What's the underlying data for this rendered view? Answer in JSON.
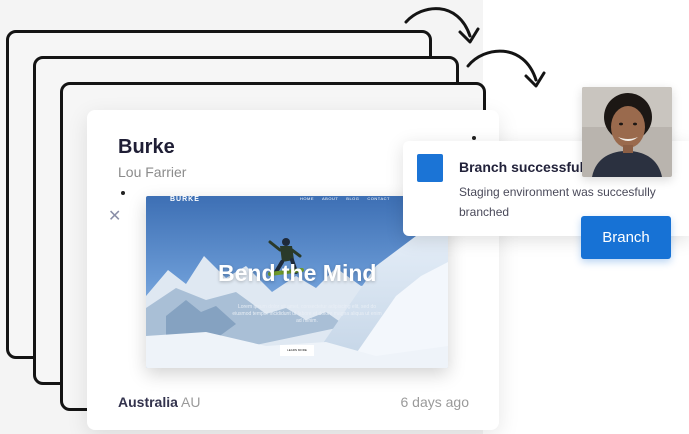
{
  "card": {
    "title": "Burke",
    "subtitle": "Lou Farrier",
    "location_name": "Australia",
    "location_code": "AU",
    "time_ago": "6 days ago"
  },
  "preview": {
    "brand": "BURKE",
    "nav": [
      "HOME",
      "ABOUT",
      "BLOG",
      "CONTACT"
    ],
    "headline": "Bend the Mind",
    "body": "Lorem ipsum dolor sit amet, consectetur adipiscing elit, sed do eiusmod tempor incididunt ut labore et dolore magna aliqua ut enim ad minim.",
    "cta": "LEARN MORE"
  },
  "toast": {
    "title": "Branch successful",
    "message": "Staging environment was succesfully branched"
  },
  "actions": {
    "branch_label": "Branch"
  },
  "colors": {
    "accent": "#1772d5",
    "stack_border": "#141414",
    "title_text": "#1f1e35"
  },
  "icons": {
    "close": "close-icon",
    "menu": "kebab-menu-icon",
    "status": "status-square-icon"
  }
}
